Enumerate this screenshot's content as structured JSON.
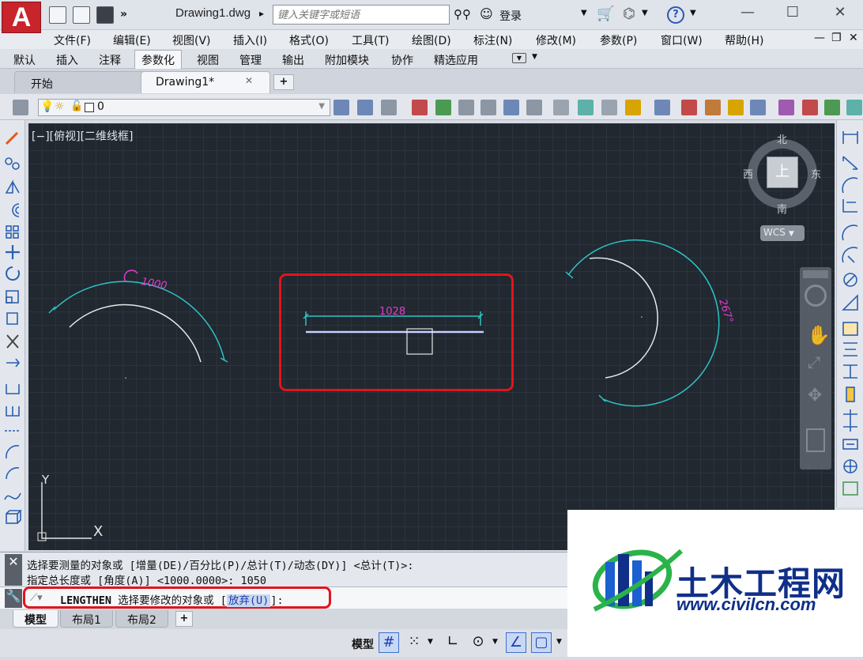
{
  "app": {
    "logo_letter": "A",
    "document_title": "Drawing1.dwg",
    "search_placeholder": "键入关键字或短语",
    "login_label": "登录",
    "window_controls": [
      "minimize-icon",
      "maximize-icon",
      "close-icon"
    ]
  },
  "menu": [
    "文件(F)",
    "编辑(E)",
    "视图(V)",
    "插入(I)",
    "格式(O)",
    "工具(T)",
    "绘图(D)",
    "标注(N)",
    "修改(M)",
    "参数(P)",
    "窗口(W)",
    "帮助(H)"
  ],
  "ribbon_tabs": [
    {
      "label": "默认",
      "active": false
    },
    {
      "label": "插入",
      "active": false
    },
    {
      "label": "注释",
      "active": false
    },
    {
      "label": "参数化",
      "active": true
    },
    {
      "label": "视图",
      "active": false
    },
    {
      "label": "管理",
      "active": false
    },
    {
      "label": "输出",
      "active": false
    },
    {
      "label": "附加模块",
      "active": false
    },
    {
      "label": "协作",
      "active": false
    },
    {
      "label": "精选应用",
      "active": false
    }
  ],
  "file_tabs": [
    {
      "label": "开始",
      "active": false
    },
    {
      "label": "Drawing1*",
      "active": true
    }
  ],
  "layer_toolbar": {
    "current_layer": "0"
  },
  "viewport": {
    "label": "[−][俯视][二维线框]",
    "viewcube": {
      "north": "北",
      "south": "南",
      "east": "东",
      "west": "西",
      "face": "上",
      "ucs": "WCS"
    },
    "ucs_x": "X",
    "ucs_y": "Y"
  },
  "drawing": {
    "left_arc_dimension": "1000",
    "line_dimension": "1028",
    "right_arc_angle": "267°",
    "colors": {
      "dimension_text": "#e23ccc",
      "dimension_line": "#2ec4c4",
      "geometry": "#e8e8e8",
      "selected_line": "#a9b6ff",
      "highlight_frame": "#e2141c"
    }
  },
  "command": {
    "history": [
      "选择要测量的对象或 [增量(DE)/百分比(P)/总计(T)/动态(DY)] <总计(T)>:",
      "指定总长度或 [角度(A)] <1000.0000>: 1050"
    ],
    "prompt_command": "LENGTHEN",
    "prompt_text": " 选择要修改的对象或 [",
    "prompt_option": "放弃(U)",
    "prompt_end": "]:"
  },
  "layout_tabs": [
    {
      "label": "模型",
      "active": true
    },
    {
      "label": "布局1",
      "active": false
    },
    {
      "label": "布局2",
      "active": false
    }
  ],
  "status_bar": {
    "model_label": "模型"
  },
  "watermark": {
    "title": "土木工程网",
    "url": "www.civilcn.com"
  }
}
